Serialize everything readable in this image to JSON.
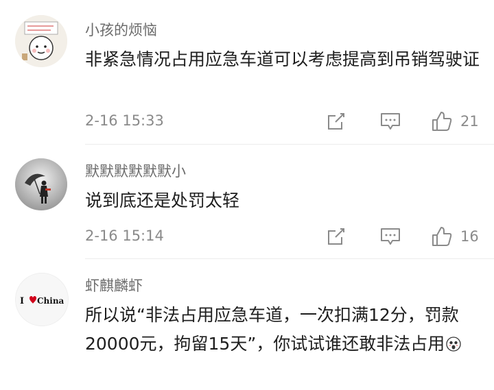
{
  "comments": [
    {
      "username": "小孩的烦恼",
      "text": "非紧急情况占用应急车道可以考虑提高到吊销驾驶证",
      "time": "2-16 15:33",
      "likes": "21",
      "avatar_icon": "cartoon-child-avatar"
    },
    {
      "username": "默默默默默默小",
      "text": "说到底还是处罚太轻",
      "time": "2-16 15:14",
      "likes": "16",
      "avatar_icon": "silhouette-umbrella-avatar"
    },
    {
      "username": "虾麒麟虾",
      "text": "所以说“非法占用应急车道，一次扣满12分，罚款20000元，拘留15天”，你试试谁还敢非法占用",
      "avatar_text": "I ♥ China",
      "avatar_icon": "i-love-china-avatar",
      "trailing_icon": "shocked-face-emoji"
    }
  ],
  "colors": {
    "text": "#1e1e1e",
    "secondary": "#8a8a8a",
    "username": "#6b6b6b",
    "divider": "#ececec",
    "heart": "#d0021b"
  }
}
